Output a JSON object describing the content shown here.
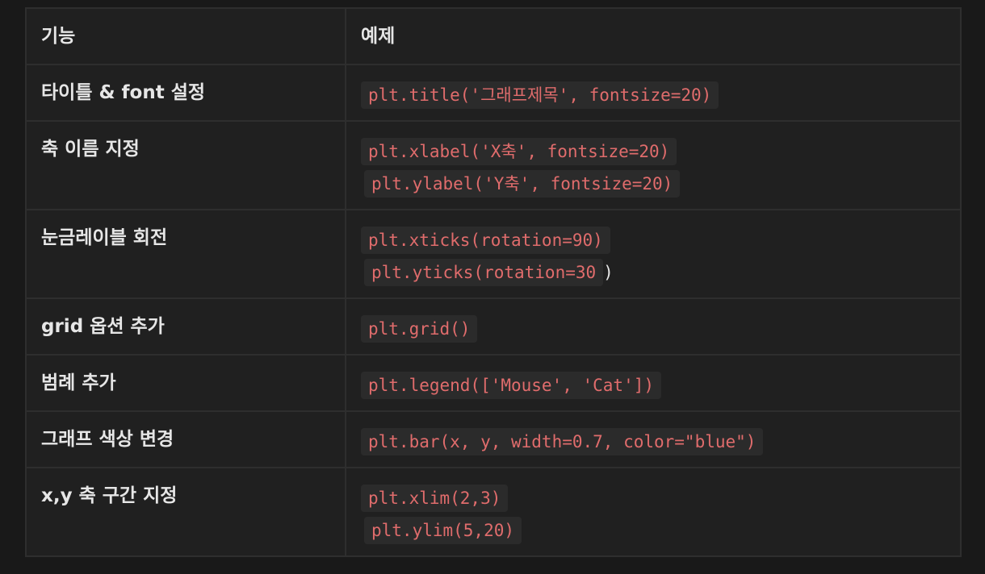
{
  "table": {
    "headers": {
      "feature": "기능",
      "example": "예제"
    },
    "rows": [
      {
        "feature": "타이틀 & font 설정",
        "lines": [
          "plt.title('그래프제목', fontsize=20)"
        ]
      },
      {
        "feature": "축 이름 지정",
        "lines": [
          "plt.xlabel('X축', fontsize=20)",
          "plt.ylabel('Y축', fontsize=20)"
        ]
      },
      {
        "feature": "눈금레이블 회전",
        "lines": [
          "plt.xticks(rotation=90)",
          "plt.yticks(rotation=30"
        ],
        "trailing": ")"
      },
      {
        "feature": "grid 옵션 추가",
        "lines": [
          "plt.grid()"
        ]
      },
      {
        "feature": "범례 추가",
        "lines": [
          "plt.legend(['Mouse', 'Cat'])"
        ]
      },
      {
        "feature": "그래프 색상 변경",
        "lines": [
          "plt.bar(x, y, width=0.7, color=\"blue\")"
        ]
      },
      {
        "feature": "x,y 축 구간 지정",
        "lines": [
          "plt.xlim(2,3)",
          "plt.ylim(5,20)"
        ]
      }
    ]
  },
  "colors": {
    "background": "#191919",
    "table_background": "#202020",
    "border": "#2e2e2e",
    "text": "#e6e6e6",
    "code_text": "#e06c6c",
    "code_background": "#2b2b2b"
  }
}
